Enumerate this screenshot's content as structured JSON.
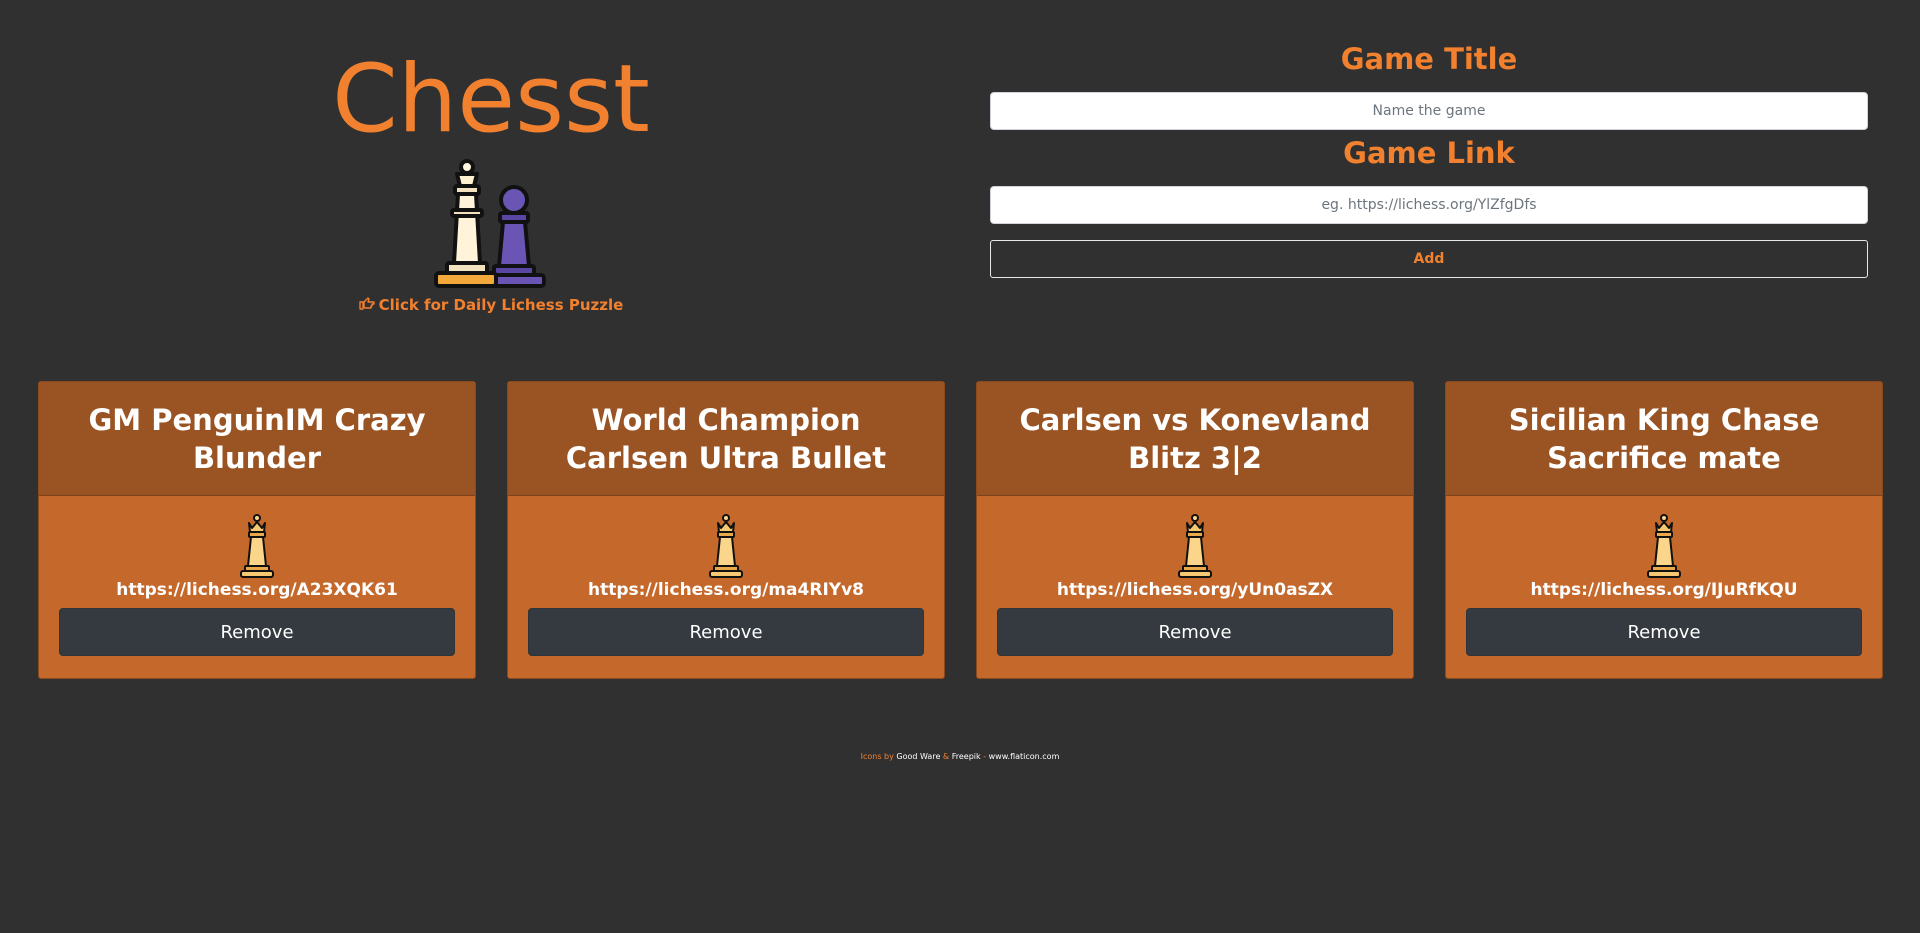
{
  "app": {
    "title": "Chesst",
    "daily_puzzle_label": "Click for Daily Lichess Puzzle",
    "accent_color": "#f2812f"
  },
  "icons": {
    "logo": "chess-king-and-pawn-icon",
    "puzzle_link": "hand-pointing-right-icon",
    "card": "chess-queen-icon"
  },
  "form": {
    "title_label": "Game Title",
    "title_placeholder": "Name the game",
    "title_value": "",
    "link_label": "Game Link",
    "link_placeholder": "eg. https://lichess.org/YlZfgDfs",
    "link_value": "",
    "add_label": "Add"
  },
  "games": [
    {
      "title": "GM PenguinIM Crazy Blunder",
      "url": "https://lichess.org/A23XQK61",
      "remove_label": "Remove"
    },
    {
      "title": "World Champion Carlsen Ultra Bullet",
      "url": "https://lichess.org/ma4RIYv8",
      "remove_label": "Remove"
    },
    {
      "title": "Carlsen vs Konevland Blitz 3|2",
      "url": "https://lichess.org/yUn0asZX",
      "remove_label": "Remove"
    },
    {
      "title": "Sicilian King Chase Sacrifice mate",
      "url": "https://lichess.org/IJuRfKQU",
      "remove_label": "Remove"
    }
  ],
  "footer": {
    "icons_by": "Icons by",
    "author1": "Good Ware",
    "amp": "&",
    "author2": "Freepik",
    "dash": "-",
    "site": "www.flaticon.com"
  },
  "colors": {
    "background": "#303030",
    "card_header": "#9a5424",
    "card_body": "#c4692b",
    "remove_button": "#343a40"
  }
}
